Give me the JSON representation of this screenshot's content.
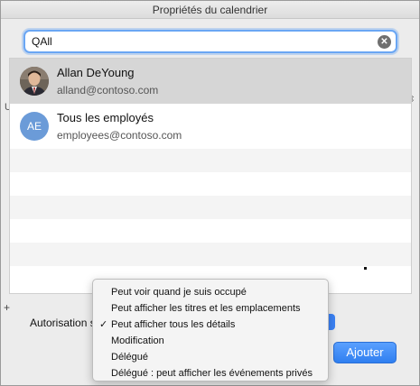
{
  "window": {
    "title": "Propriétés du calendrier"
  },
  "search": {
    "value": "QAll"
  },
  "suggestions": [
    {
      "name": "Allan DeYoung",
      "email": "alland@contoso.com",
      "avatar": "photo",
      "selected": true
    },
    {
      "name": "Tous les employés",
      "email": "employees@contoso.com",
      "avatar": "initials",
      "initials": "AE",
      "selected": false
    }
  ],
  "background": {
    "permission_label": "Autorisation s",
    "add_button": "Ajouter",
    "left_partial_label": "U",
    "plus_glyph": "+"
  },
  "permission_menu": {
    "items": [
      "Peut voir quand je suis occupé",
      "Peut afficher les titres et les emplacements",
      "Peut afficher tous les détails",
      "Modification",
      "Délégué",
      "Délégué : peut afficher les événements privés"
    ],
    "checked_item": "Peut afficher tous les détails"
  },
  "colors": {
    "accent": "#2f7ff0",
    "focus_ring": "#6aa6f3",
    "avatar_initials_bg": "#6b9bd8"
  }
}
